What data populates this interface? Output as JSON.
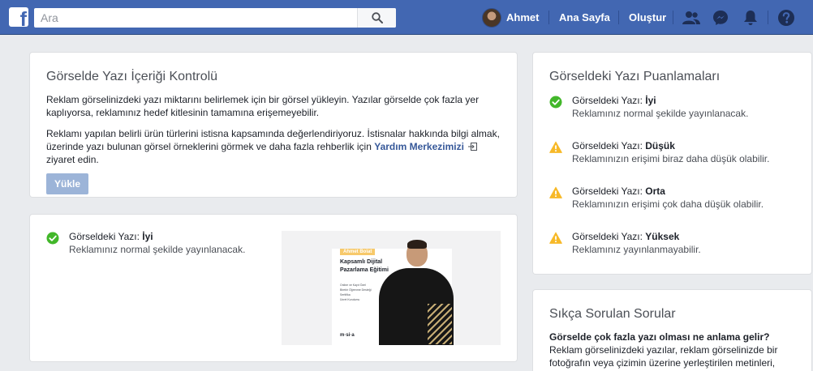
{
  "topbar": {
    "search_placeholder": "Ara",
    "user_name": "Ahmet",
    "home_label": "Ana Sayfa",
    "create_label": "Oluştur"
  },
  "check_card": {
    "title": "Görselde Yazı İçeriği Kontrolü",
    "paragraph1": "Reklam görselinizdeki yazı miktarını belirlemek için bir görsel yükleyin. Yazılar görselde çok fazla yer kaplıyorsa, reklamınız hedef kitlesinin tamamına erişemeyebilir.",
    "paragraph2_before_link": "Reklamı yapılan belirli ürün türlerini istisna kapsamında değerlendiriyoruz. İstisnalar hakkında bilgi almak, üzerinde yazı bulunan görsel örneklerini görmek ve daha fazla rehberlik için ",
    "paragraph2_link": "Yardım Merkezimizi",
    "paragraph2_after_link": " ziyaret edin.",
    "upload_button": "Yükle"
  },
  "result_card": {
    "label_prefix": "Görseldeki Yazı: ",
    "rating": "İyi",
    "description": "Reklamınız normal şekilde yayınlanacak.",
    "preview": {
      "tag": "Ahmet Bolat",
      "title_line1": "Kapsamlı Dijital",
      "title_line2": "Pazarlama Eğitimi",
      "list": [
        "Online ve Kayıt Özel",
        "Birebir Öğrenme Desteği",
        "Sertifika",
        "Ücret Kurulumu"
      ],
      "logo": "m·si·a"
    }
  },
  "ratings_card": {
    "title": "Görseldeki Yazı Puanlamaları",
    "label_prefix": "Görseldeki Yazı: ",
    "items": [
      {
        "rating": "İyi",
        "description": "Reklamınız normal şekilde yayınlanacak.",
        "status": "ok"
      },
      {
        "rating": "Düşük",
        "description": "Reklamınızın erişimi biraz daha düşük olabilir.",
        "status": "warn"
      },
      {
        "rating": "Orta",
        "description": "Reklamınızın erişimi çok daha düşük olabilir.",
        "status": "warn"
      },
      {
        "rating": "Yüksek",
        "description": "Reklamınız yayınlanmayabilir.",
        "status": "warn"
      }
    ]
  },
  "faq_card": {
    "title": "Sıkça Sorulan Sorular",
    "question": "Görselde çok fazla yazı olması ne anlama gelir?",
    "answer": "Reklam görselinizdeki yazılar, reklam görselinizde bir fotoğrafın veya çizimin üzerine yerleştirilen metinleri,"
  },
  "colors": {
    "brand": "#4267b2",
    "ok": "#42b72a",
    "warn": "#f7b928",
    "link": "#365899"
  },
  "icons": {
    "search": "search-icon",
    "friends": "friends-icon",
    "messenger": "messenger-icon",
    "notifications": "bell-icon",
    "help": "help-icon",
    "ok": "check-circle-icon",
    "warn": "warning-triangle-icon",
    "external": "external-link-icon"
  }
}
